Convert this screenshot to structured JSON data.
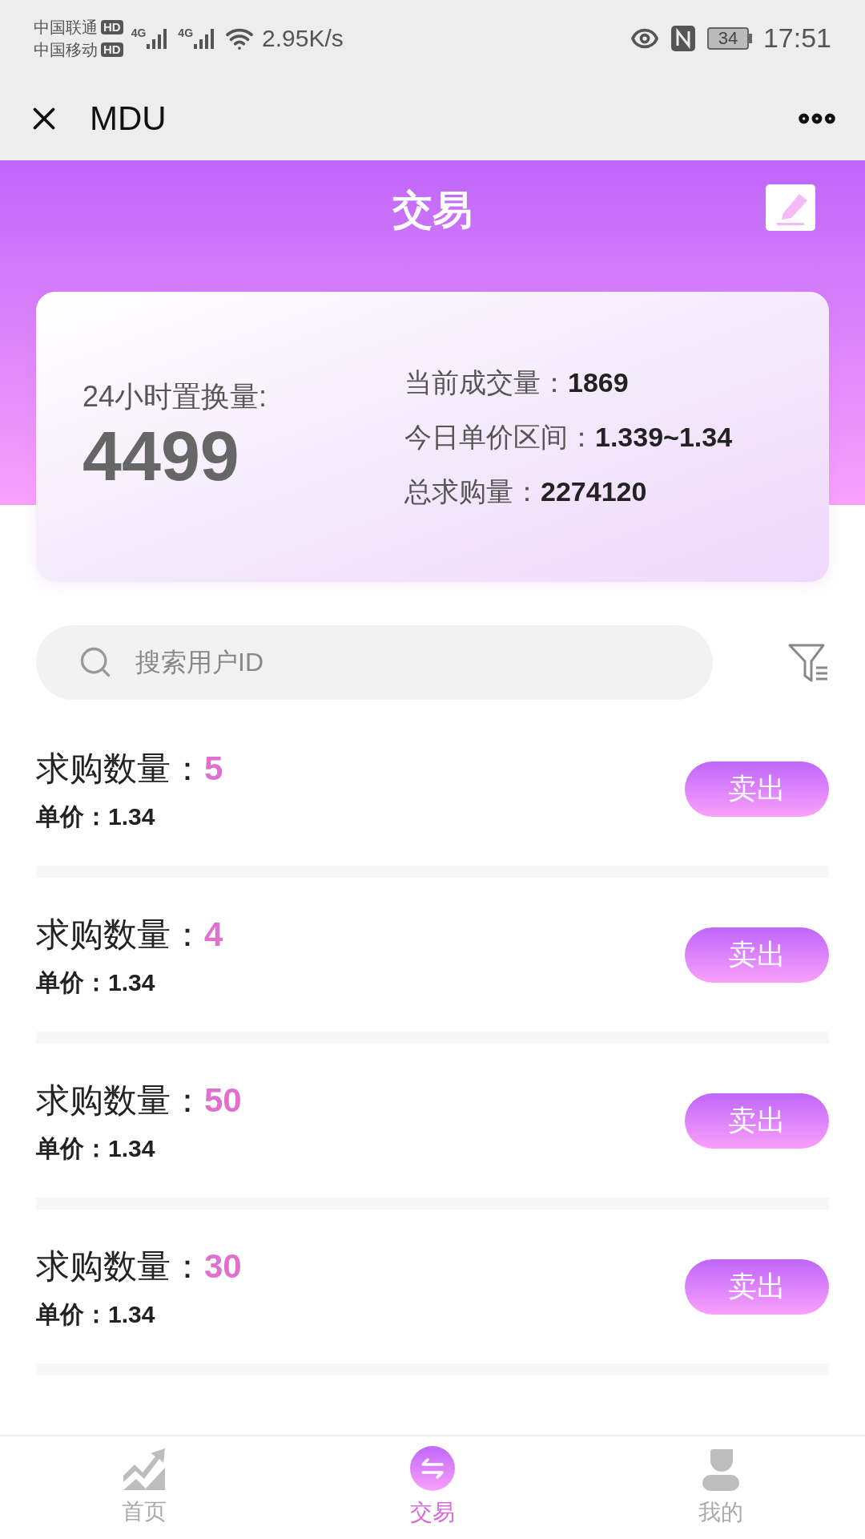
{
  "status_bar": {
    "carriers": [
      {
        "name": "中国联通",
        "badge": "HD"
      },
      {
        "name": "中国移动",
        "badge": "HD"
      }
    ],
    "signals": [
      {
        "label": "4G"
      },
      {
        "label": "4G"
      }
    ],
    "speed": "2.95K/s",
    "battery": "34",
    "time": "17:51"
  },
  "nav_bar": {
    "title": "MDU"
  },
  "header": {
    "title": "交易"
  },
  "summary": {
    "label": "24小时置换量:",
    "value": "4499",
    "stats": [
      {
        "label": "当前成交量：",
        "value": "1869"
      },
      {
        "label": "今日单价区间：",
        "value": "1.339~1.34"
      },
      {
        "label": "总求购量：",
        "value": "2274120"
      }
    ]
  },
  "search": {
    "placeholder": "搜索用户ID"
  },
  "orders": [
    {
      "label": "求购数量：",
      "quantity": "5",
      "price_label": "单价：",
      "price": "1.34",
      "button": "卖出"
    },
    {
      "label": "求购数量：",
      "quantity": "4",
      "price_label": "单价：",
      "price": "1.34",
      "button": "卖出"
    },
    {
      "label": "求购数量：",
      "quantity": "50",
      "price_label": "单价：",
      "price": "1.34",
      "button": "卖出"
    },
    {
      "label": "求购数量：",
      "quantity": "30",
      "price_label": "单价：",
      "price": "1.34",
      "button": "卖出"
    }
  ],
  "tab_bar": [
    {
      "label": "首页",
      "kind": "chart",
      "selected": false
    },
    {
      "label": "交易",
      "kind": "swap",
      "selected": true
    },
    {
      "label": "我的",
      "kind": "person",
      "selected": false
    }
  ]
}
